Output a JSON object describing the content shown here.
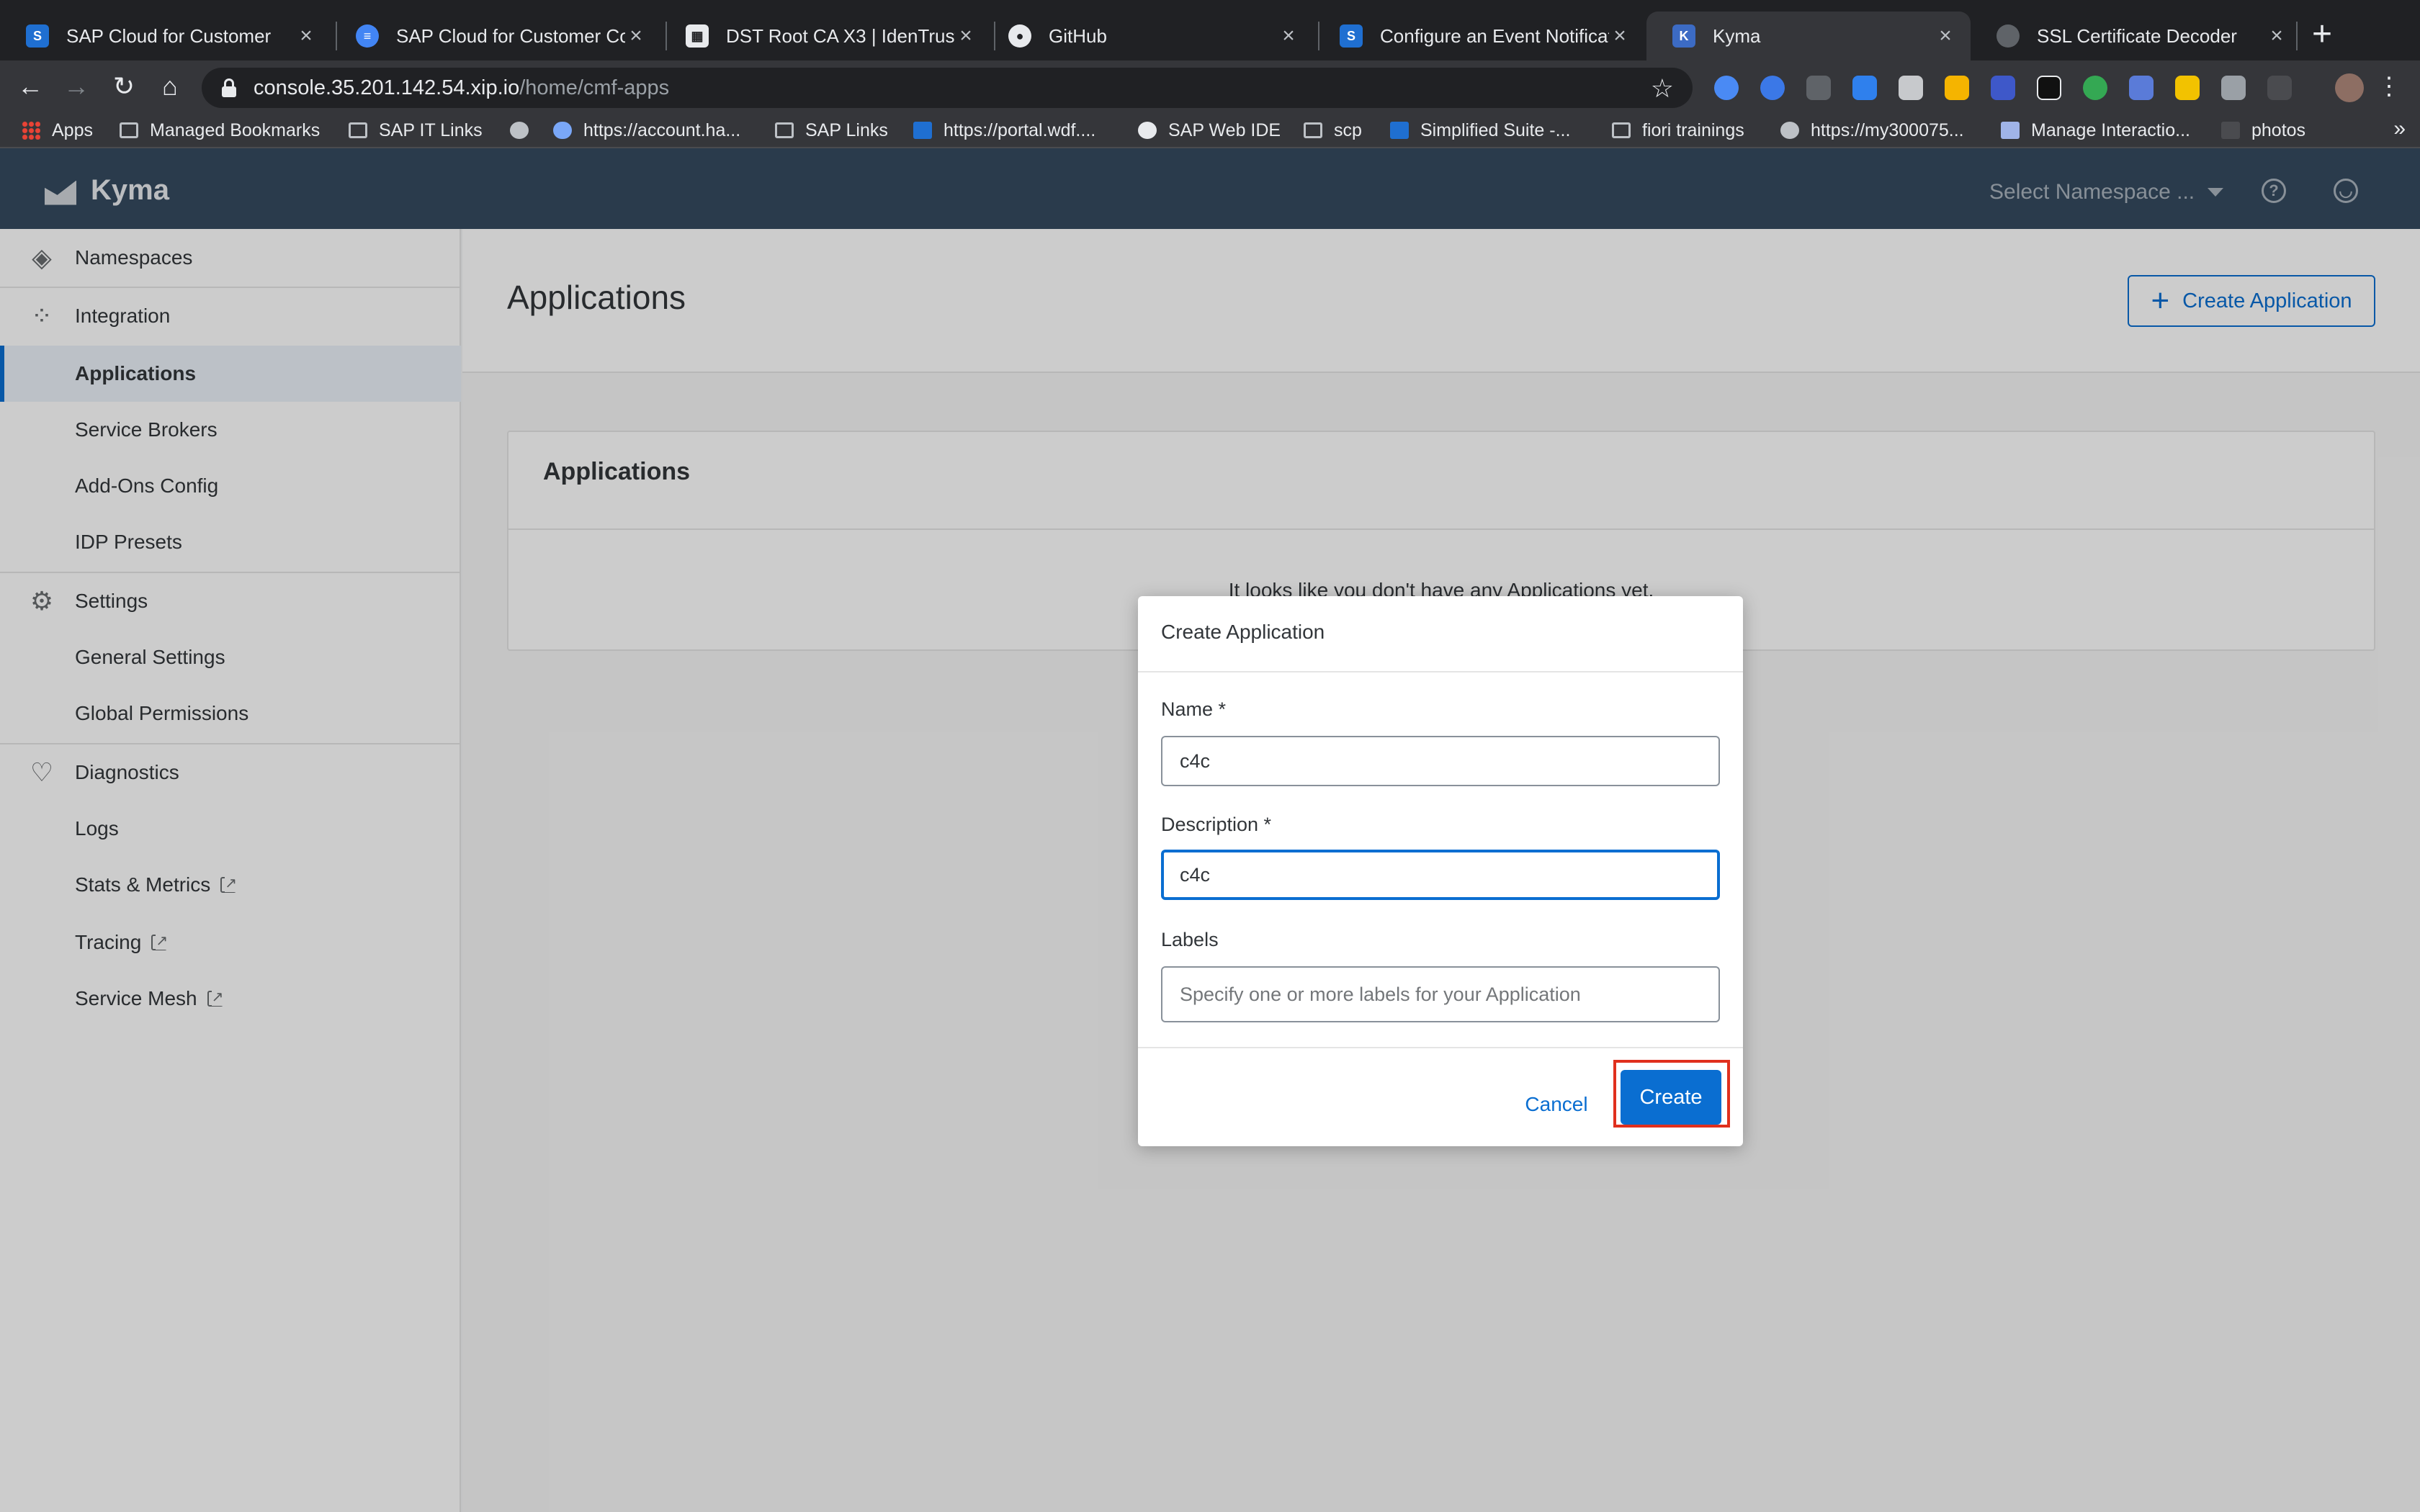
{
  "browser": {
    "tabs": [
      {
        "title": "SAP Cloud for Customer",
        "favicon": "sap-icon",
        "active": false
      },
      {
        "title": "SAP Cloud for Customer Con",
        "favicon": "docs-icon",
        "active": false
      },
      {
        "title": "DST Root CA X3 | IdenTrust",
        "favicon": "identrust-icon",
        "active": false
      },
      {
        "title": "GitHub",
        "favicon": "github-icon",
        "active": false
      },
      {
        "title": "Configure an Event Notificati",
        "favicon": "sap-icon",
        "active": false
      },
      {
        "title": "Kyma",
        "favicon": "kyma-icon",
        "active": true
      },
      {
        "title": "SSL Certificate Decoder",
        "favicon": "globe-icon",
        "active": false
      }
    ],
    "url_host": "console.35.201.142.54.xip.io",
    "url_path": "/home/cmf-apps",
    "bookmarks": [
      {
        "label": "Apps",
        "icon": "apps-grid-icon"
      },
      {
        "label": "Managed Bookmarks",
        "icon": "folder-icon"
      },
      {
        "label": "SAP IT Links",
        "icon": "folder-icon"
      },
      {
        "label": "",
        "icon": "globe-icon"
      },
      {
        "label": "https://account.ha...",
        "icon": "cloud-icon"
      },
      {
        "label": "SAP Links",
        "icon": "folder-icon"
      },
      {
        "label": "https://portal.wdf....",
        "icon": "sap-icon"
      },
      {
        "label": "SAP Web IDE",
        "icon": "webide-icon"
      },
      {
        "label": "scp",
        "icon": "folder-icon"
      },
      {
        "label": "Simplified Suite -...",
        "icon": "sap-icon"
      },
      {
        "label": "fiori trainings",
        "icon": "folder-icon"
      },
      {
        "label": "https://my300075...",
        "icon": "globe-icon"
      },
      {
        "label": "Manage Interactio...",
        "icon": "image-icon"
      },
      {
        "label": "photos",
        "icon": "photos-icon"
      }
    ]
  },
  "app": {
    "name": "Kyma",
    "namespace_placeholder": "Select Namespace ...",
    "help_icon": "help-icon",
    "user_icon": "user-icon"
  },
  "sidebar": {
    "groups": [
      {
        "label": "Namespaces",
        "icon": "namespaces-icon"
      },
      {
        "label": "Integration",
        "icon": "integration-icon"
      },
      {
        "label": "Settings",
        "icon": "settings-icon"
      },
      {
        "label": "Diagnostics",
        "icon": "diagnostics-icon"
      }
    ],
    "integration_items": [
      "Applications",
      "Service Brokers",
      "Add-Ons Config",
      "IDP Presets"
    ],
    "settings_items": [
      "General Settings",
      "Global Permissions"
    ],
    "diagnostics_items": [
      "Logs",
      "Stats & Metrics",
      "Tracing",
      "Service Mesh"
    ]
  },
  "main": {
    "page_title": "Applications",
    "create_button": "Create Application",
    "panel_title": "Applications",
    "empty_text": "It looks like you don't have any Applications yet."
  },
  "modal": {
    "title": "Create Application",
    "name_label": "Name *",
    "name_value": "c4c",
    "description_label": "Description *",
    "description_value": "c4c",
    "labels_label": "Labels",
    "labels_placeholder": "Specify one or more labels for your Application",
    "cancel": "Cancel",
    "create": "Create",
    "highlight_color": "#e0301e"
  },
  "colors": {
    "accent": "#0a6ed1",
    "header": "#354a5f"
  }
}
